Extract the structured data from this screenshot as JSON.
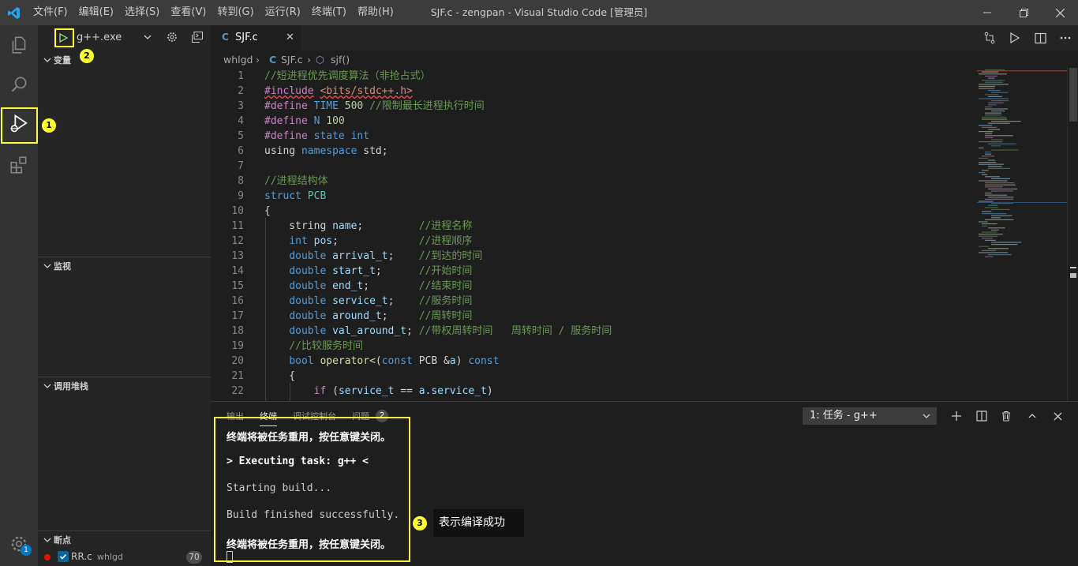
{
  "titlebar": {
    "menu": [
      "文件(F)",
      "编辑(E)",
      "选择(S)",
      "查看(V)",
      "转到(G)",
      "运行(R)",
      "终端(T)",
      "帮助(H)"
    ],
    "window_title": "SJF.c - zengpan - Visual Studio Code [管理员]"
  },
  "activitybar": {
    "items": [
      "explorer-icon",
      "search-icon",
      "run-debug-icon",
      "extensions-icon"
    ],
    "settings_badge": "1"
  },
  "sidebar": {
    "debug_config": "g++.exe",
    "sections": {
      "variables": "变量",
      "watch": "监视",
      "callstack": "调用堆栈",
      "breakpoints": "断点"
    },
    "breakpoint": {
      "file": "RR.c",
      "dir": "whlgd",
      "count": "70"
    }
  },
  "editor": {
    "tab": {
      "icon": "C",
      "label": "SJF.c"
    },
    "breadcrumb": {
      "folder": "whlgd",
      "file": "SJF.c",
      "symbol": "sjf()"
    },
    "lines": [
      {
        "n": "1",
        "tokens": [
          [
            "cm",
            "//短进程优先调度算法（非抢占式）"
          ]
        ]
      },
      {
        "n": "2",
        "tokens": [
          [
            "pp squiggle",
            "#include"
          ],
          [
            "pl",
            " "
          ],
          [
            "str squiggle",
            "<bits/stdc++.h>"
          ]
        ]
      },
      {
        "n": "3",
        "tokens": [
          [
            "pp",
            "#define"
          ],
          [
            "pl",
            " "
          ],
          [
            "kw",
            "TIME"
          ],
          [
            "pl",
            " "
          ],
          [
            "num",
            "500"
          ],
          [
            "pl",
            " "
          ],
          [
            "cm",
            "//限制最长进程执行时间"
          ]
        ]
      },
      {
        "n": "4",
        "tokens": [
          [
            "pp",
            "#define"
          ],
          [
            "pl",
            " "
          ],
          [
            "kw",
            "N"
          ],
          [
            "pl",
            " "
          ],
          [
            "num",
            "100"
          ]
        ]
      },
      {
        "n": "5",
        "tokens": [
          [
            "pp",
            "#define"
          ],
          [
            "pl",
            " "
          ],
          [
            "kw",
            "state"
          ],
          [
            "pl",
            " "
          ],
          [
            "kw",
            "int"
          ]
        ]
      },
      {
        "n": "6",
        "tokens": [
          [
            "pl",
            "using "
          ],
          [
            "kw",
            "namespace"
          ],
          [
            "pl",
            " std;"
          ]
        ]
      },
      {
        "n": "7",
        "tokens": []
      },
      {
        "n": "8",
        "tokens": [
          [
            "cm",
            "//进程结构体"
          ]
        ]
      },
      {
        "n": "9",
        "tokens": [
          [
            "kw",
            "struct"
          ],
          [
            "pl",
            " "
          ],
          [
            "ty",
            "PCB"
          ]
        ]
      },
      {
        "n": "10",
        "tokens": [
          [
            "pl",
            "{"
          ]
        ]
      },
      {
        "n": "11",
        "tokens": [
          [
            "pl",
            "    string "
          ],
          [
            "var",
            "name"
          ],
          [
            "pl",
            ";         "
          ],
          [
            "cm",
            "//进程名称"
          ]
        ]
      },
      {
        "n": "12",
        "tokens": [
          [
            "pl",
            "    "
          ],
          [
            "kw",
            "int"
          ],
          [
            "pl",
            " "
          ],
          [
            "var",
            "pos"
          ],
          [
            "pl",
            ";             "
          ],
          [
            "cm",
            "//进程顺序"
          ]
        ]
      },
      {
        "n": "13",
        "tokens": [
          [
            "pl",
            "    "
          ],
          [
            "kw",
            "double"
          ],
          [
            "pl",
            " "
          ],
          [
            "var",
            "arrival_t"
          ],
          [
            "pl",
            ";    "
          ],
          [
            "cm",
            "//到达的时间"
          ]
        ]
      },
      {
        "n": "14",
        "tokens": [
          [
            "pl",
            "    "
          ],
          [
            "kw",
            "double"
          ],
          [
            "pl",
            " "
          ],
          [
            "var",
            "start_t"
          ],
          [
            "pl",
            ";      "
          ],
          [
            "cm",
            "//开始时间"
          ]
        ]
      },
      {
        "n": "15",
        "tokens": [
          [
            "pl",
            "    "
          ],
          [
            "kw",
            "double"
          ],
          [
            "pl",
            " "
          ],
          [
            "var",
            "end_t"
          ],
          [
            "pl",
            ";        "
          ],
          [
            "cm",
            "//结束时间"
          ]
        ]
      },
      {
        "n": "16",
        "tokens": [
          [
            "pl",
            "    "
          ],
          [
            "kw",
            "double"
          ],
          [
            "pl",
            " "
          ],
          [
            "var",
            "service_t"
          ],
          [
            "pl",
            ";    "
          ],
          [
            "cm",
            "//服务时间"
          ]
        ]
      },
      {
        "n": "17",
        "tokens": [
          [
            "pl",
            "    "
          ],
          [
            "kw",
            "double"
          ],
          [
            "pl",
            " "
          ],
          [
            "var",
            "around_t"
          ],
          [
            "pl",
            ";     "
          ],
          [
            "cm",
            "//周转时间"
          ]
        ]
      },
      {
        "n": "18",
        "tokens": [
          [
            "pl",
            "    "
          ],
          [
            "kw",
            "double"
          ],
          [
            "pl",
            " "
          ],
          [
            "var",
            "val_around_t"
          ],
          [
            "pl",
            "; "
          ],
          [
            "cm",
            "//带权周转时间   周转时间 / 服务时间"
          ]
        ]
      },
      {
        "n": "19",
        "tokens": [
          [
            "pl",
            "    "
          ],
          [
            "cm",
            "//比较服务时间"
          ]
        ]
      },
      {
        "n": "20",
        "tokens": [
          [
            "pl",
            "    "
          ],
          [
            "kw",
            "bool"
          ],
          [
            "pl",
            " "
          ],
          [
            "fn",
            "operator<"
          ],
          [
            "pl",
            "("
          ],
          [
            "kw",
            "const"
          ],
          [
            "pl",
            " PCB &"
          ],
          [
            "var",
            "a"
          ],
          [
            "pl",
            ") "
          ],
          [
            "kw",
            "const"
          ]
        ]
      },
      {
        "n": "21",
        "tokens": [
          [
            "pl",
            "    {"
          ]
        ]
      },
      {
        "n": "22",
        "tokens": [
          [
            "pl",
            "        "
          ],
          [
            "pp",
            "if"
          ],
          [
            "pl",
            " ("
          ],
          [
            "var",
            "service_t"
          ],
          [
            "pl",
            " == "
          ],
          [
            "var",
            "a"
          ],
          [
            "pl",
            "."
          ],
          [
            "var",
            "service_t"
          ],
          [
            "pl",
            ")"
          ]
        ]
      }
    ]
  },
  "panel": {
    "tabs": [
      "输出",
      "终端",
      "调试控制台",
      "问题"
    ],
    "problems_count": "2",
    "terminal_select": "1: 任务 - g++",
    "terminal_lines": [
      {
        "text": "终端将被任务重用，按任意键关闭。",
        "bold": true
      },
      {
        "text": "> Executing task: g++ <",
        "bold": true
      },
      {
        "text": "Starting build...",
        "bold": false
      },
      {
        "text": "Build finished successfully.",
        "bold": false
      },
      {
        "text": "终端将被任务重用，按任意键关闭。",
        "bold": true
      }
    ]
  },
  "annotations": {
    "marker_1": "1",
    "marker_2": "2",
    "marker_3": "3",
    "label_3": "表示编译成功",
    "color": "#ffff33"
  }
}
